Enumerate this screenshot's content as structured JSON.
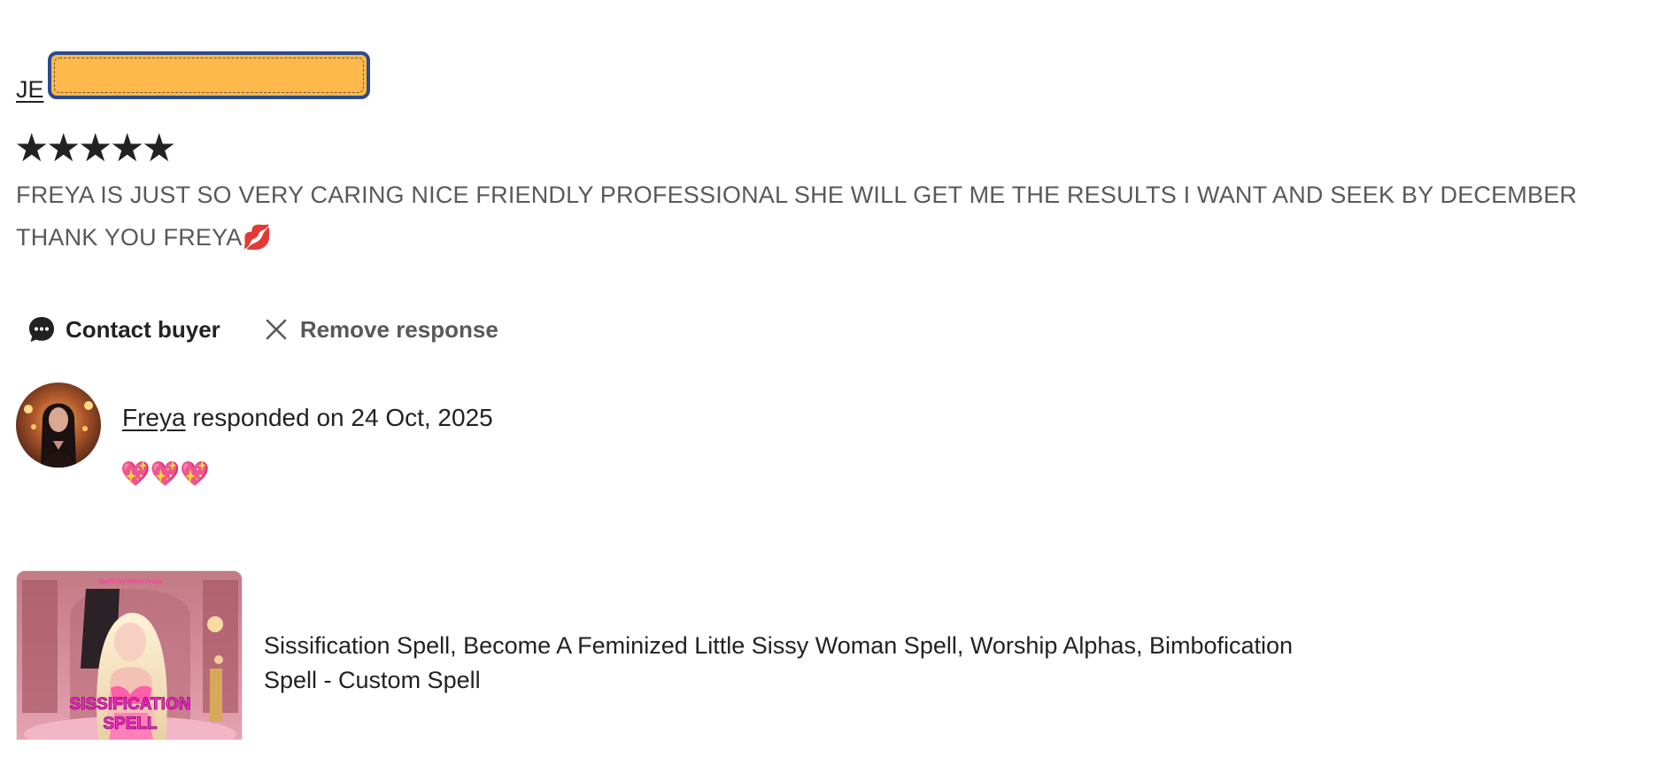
{
  "review": {
    "buyer_name": "JE",
    "rating": 5,
    "stars": [
      "★",
      "★",
      "★",
      "★",
      "★"
    ],
    "text": "FREYA IS JUST SO VERY CARING NICE FRIENDLY PROFESSIONAL SHE WILL GET ME THE RESULTS I WANT AND SEEK BY DECEMBER THANK YOU FREYA💋"
  },
  "actions": {
    "contact_label": "Contact buyer",
    "remove_label": "Remove response"
  },
  "response": {
    "seller_name": "Freya",
    "meta_text": " responded on 24 Oct, 2025",
    "text": "💖💖💖"
  },
  "listing": {
    "thumb_header": "Spells by Witch Freya",
    "thumb_caption_line1": "SISSIFICATION",
    "thumb_caption_line2": "SPELL",
    "title": "Sissification Spell, Become A Feminized Little Sissy Woman Spell, Worship Alphas, Bimbofication Spell - Custom Spell"
  },
  "colors": {
    "text_primary": "#222222",
    "text_secondary": "#595959",
    "redaction_fill": "#ffb84a",
    "redaction_border": "#2c4a8e"
  },
  "icons": {
    "contact": "chat-bubble-icon",
    "remove": "close-icon",
    "star": "star-icon"
  }
}
